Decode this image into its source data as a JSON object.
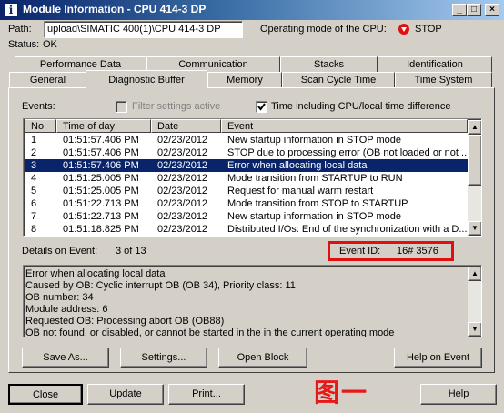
{
  "window": {
    "title": "Module Information - CPU 414-3 DP",
    "title_icon": "i",
    "controls": [
      "_",
      "□",
      "×"
    ]
  },
  "path": {
    "label": "Path:",
    "value": "upload\\SIMATIC 400(1)\\CPU 414-3 DP"
  },
  "operating_mode": {
    "label": "Operating mode of the  CPU:",
    "value": "STOP"
  },
  "status": {
    "label": "Status:",
    "value": "OK"
  },
  "tabs_top": [
    "Performance Data",
    "Communication",
    "Stacks",
    "Identification"
  ],
  "tabs_bottom": [
    "General",
    "Diagnostic Buffer",
    "Memory",
    "Scan Cycle Time",
    "Time System"
  ],
  "active_tab": "Diagnostic Buffer",
  "events": {
    "label": "Events:",
    "filter_label": "Filter settings active",
    "filter_checked": false,
    "time_label": "Time including CPU/local time difference",
    "time_checked": true,
    "columns": [
      "No.",
      "Time of day",
      "Date",
      "Event"
    ],
    "rows": [
      {
        "no": "1",
        "time": "01:51:57.406 PM",
        "date": "02/23/2012",
        "event": "New startup information in STOP mode"
      },
      {
        "no": "2",
        "time": "01:51:57.406 PM",
        "date": "02/23/2012",
        "event": "STOP due to processing error (OB not loaded or not ..."
      },
      {
        "no": "3",
        "time": "01:51:57.406 PM",
        "date": "02/23/2012",
        "event": "Error when allocating local data"
      },
      {
        "no": "4",
        "time": "01:51:25.005 PM",
        "date": "02/23/2012",
        "event": "Mode transition from STARTUP to RUN"
      },
      {
        "no": "5",
        "time": "01:51:25.005 PM",
        "date": "02/23/2012",
        "event": "Request for manual warm restart"
      },
      {
        "no": "6",
        "time": "01:51:22.713 PM",
        "date": "02/23/2012",
        "event": "Mode transition from STOP to STARTUP"
      },
      {
        "no": "7",
        "time": "01:51:22.713 PM",
        "date": "02/23/2012",
        "event": "New startup information in STOP mode"
      },
      {
        "no": "8",
        "time": "01:51:18.825 PM",
        "date": "02/23/2012",
        "event": "Distributed I/Os: End of the synchronization with a D..."
      }
    ],
    "selected_row": 2
  },
  "details": {
    "label": "Details on Event:",
    "counter": "3 of 13",
    "event_id_label": "Event ID:",
    "event_id_value": "16# 3576",
    "lines": [
      "Error when allocating local data",
      "Caused by OB: Cyclic interrupt OB (OB  34), Priority class:  11",
      "OB number:   34",
      "Module address:    6",
      "Requested OB: Processing abort OB (OB88)",
      "OB not found, or disabled, or cannot be started in the in the current operating mode"
    ]
  },
  "buttons_inner": [
    "Save As...",
    "Settings...",
    "Open Block",
    "Help on Event"
  ],
  "buttons_bottom": [
    "Close",
    "Update",
    "Print...",
    "Help"
  ],
  "watermark": "图一",
  "colors": {
    "highlight": "#0a246a",
    "annotation_red": "#e01010",
    "stop_red": "#e01010"
  }
}
